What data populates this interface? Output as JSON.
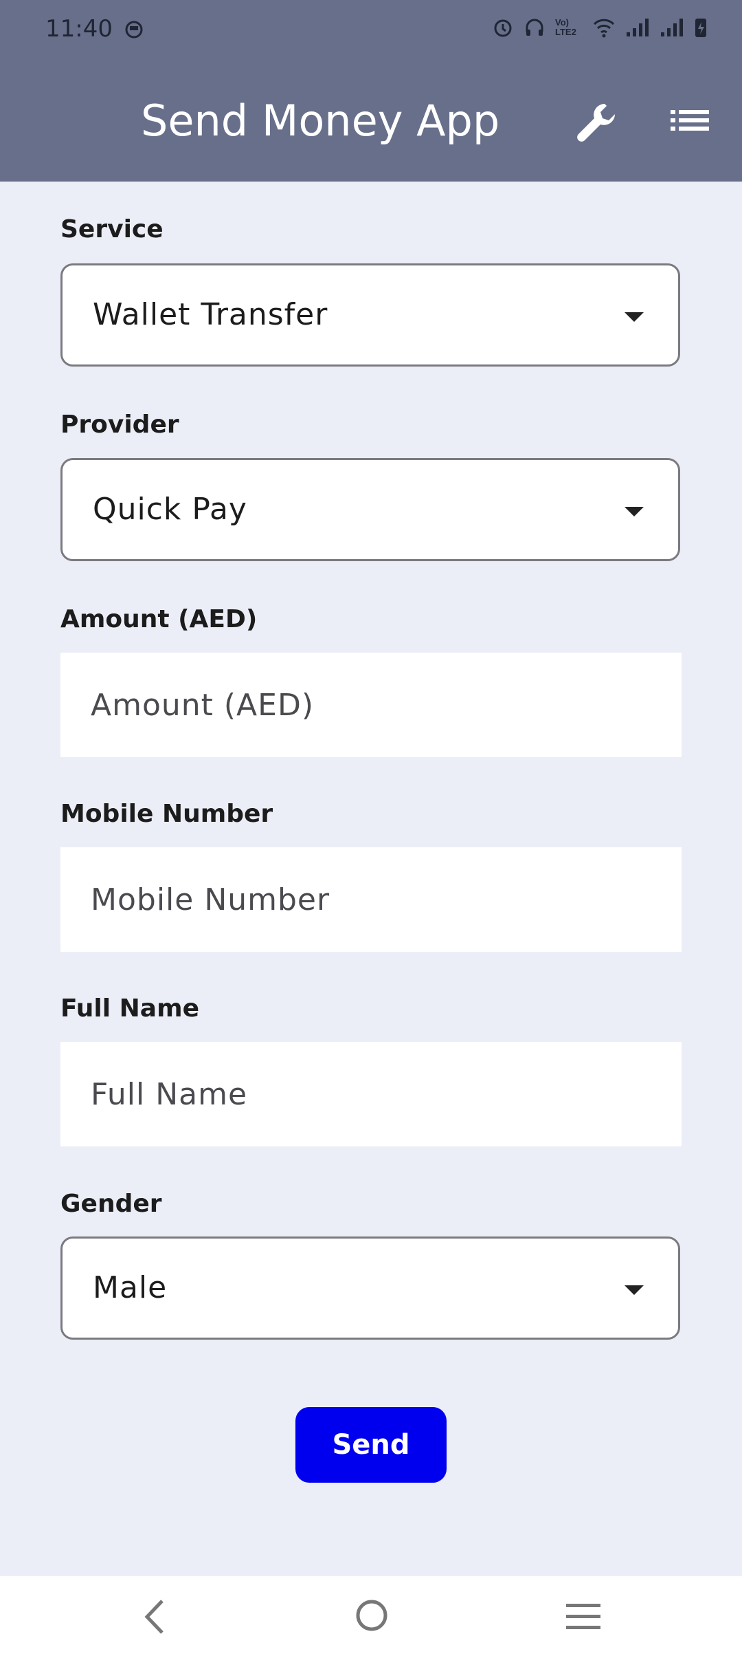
{
  "status_bar": {
    "time": "11:40",
    "network_label": "Vo) LTE2"
  },
  "header": {
    "title": "Send Money App",
    "tool_icon": "wrench-icon",
    "menu_icon": "list-icon"
  },
  "form": {
    "service": {
      "label": "Service",
      "value": "Wallet Transfer"
    },
    "provider": {
      "label": "Provider",
      "value": "Quick Pay"
    },
    "amount": {
      "label": "Amount (AED)",
      "placeholder": "Amount (AED)",
      "value": ""
    },
    "mobile": {
      "label": "Mobile Number",
      "placeholder": "Mobile Number",
      "value": ""
    },
    "full_name": {
      "label": "Full Name",
      "placeholder": "Full Name",
      "value": ""
    },
    "gender": {
      "label": "Gender",
      "value": "Male"
    },
    "send_label": "Send"
  },
  "colors": {
    "appbar": "#676f8b",
    "background": "#eceef7",
    "send_button": "#0000ee"
  }
}
